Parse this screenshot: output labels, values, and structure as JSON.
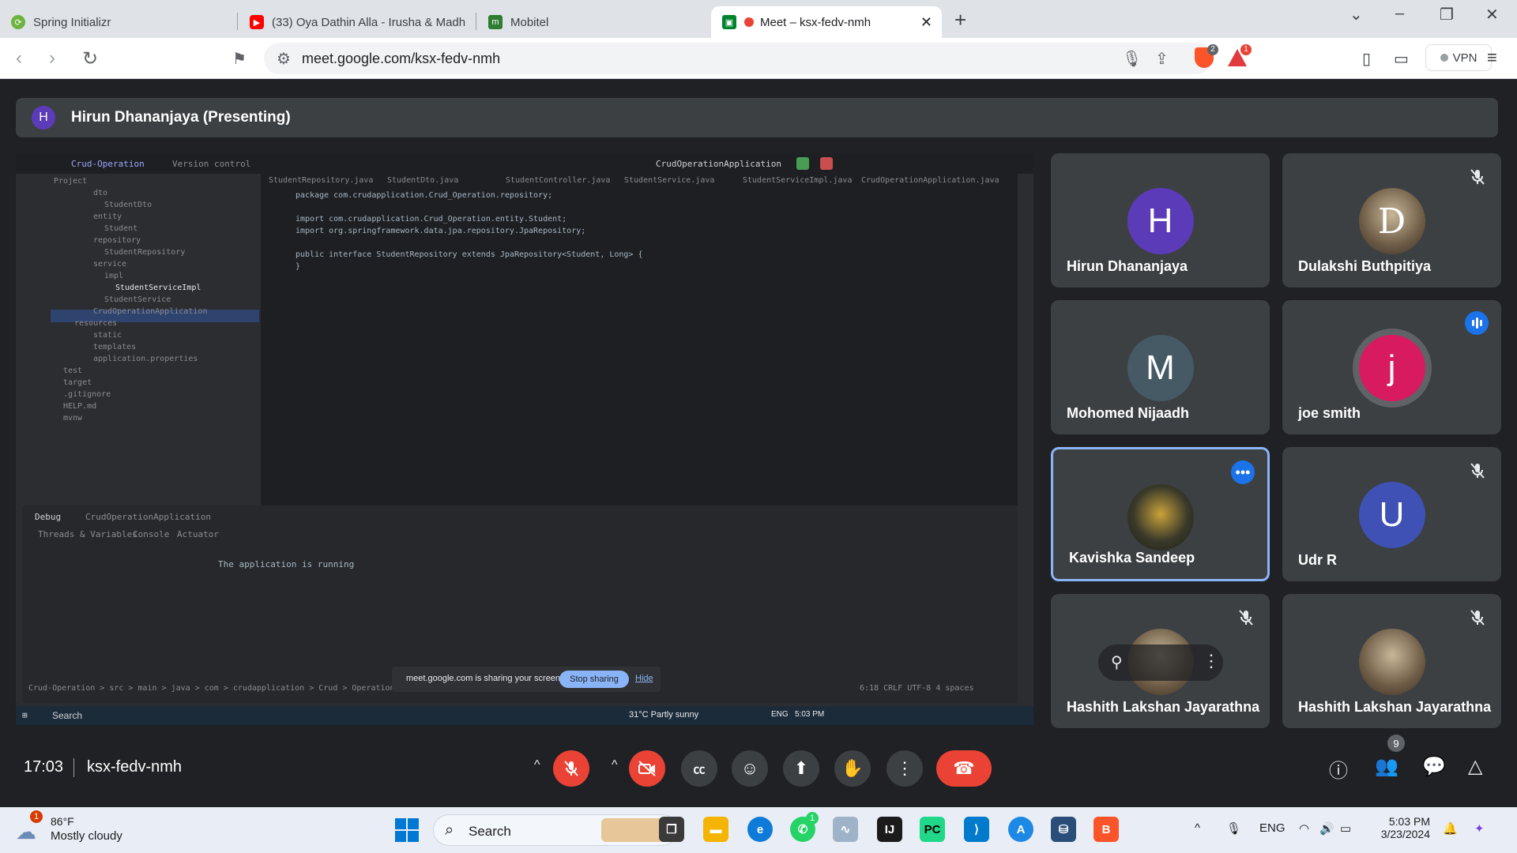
{
  "browser": {
    "tabs": [
      {
        "title": "Spring Initializr",
        "icon": "spring-icon"
      },
      {
        "title": "(33) Oya Dathin Alla - Irusha & Madh",
        "icon": "youtube-icon"
      },
      {
        "title": "Mobitel",
        "icon": "mobitel-icon"
      },
      {
        "title": "Meet – ksx-fedv-nmh",
        "icon": "meet-icon"
      }
    ],
    "url": "meet.google.com/ksx-fedv-nmh",
    "vpn_label": "VPN",
    "shields_badge": "2",
    "rewards_badge": "1"
  },
  "meet": {
    "presenter_initial": "H",
    "presenter_banner": "Hirun Dhananjaya (Presenting)",
    "participants": [
      {
        "name": "Hirun Dhananjaya",
        "initial": "H",
        "color": "#5b3bb8"
      },
      {
        "name": "Dulakshi Buthpitiya",
        "initial": "D",
        "color": "#c9b79a"
      },
      {
        "name": "Mohomed Nijaadh",
        "initial": "M",
        "color": "#455a64"
      },
      {
        "name": "joe smith",
        "initial": "j",
        "color": "#d81b60"
      },
      {
        "name": "Kavishka Sandeep",
        "initial": "",
        "color": "#4a4a3a"
      },
      {
        "name": "Udr R",
        "initial": "U",
        "color": "#3f51b5"
      },
      {
        "name": "Hashith Lakshan Jayarathna",
        "initial": "",
        "color": "#8d7a66"
      },
      {
        "name": "Hashith Lakshan Jayarathna",
        "initial": "",
        "color": "#8d7a66"
      }
    ],
    "more_options": "•••",
    "shared_screen": {
      "project_name": "Crud-Operation",
      "version_control": "Version control",
      "run_config": "CrudOperationApplication",
      "editor_tabs": [
        "StudentRepository.java",
        "StudentDto.java",
        "StudentController.java",
        "StudentService.java",
        "StudentServiceImpl.java",
        "CrudOperationApplication.java"
      ],
      "code_lines": [
        "package com.crudapplication.Crud_Operation.repository;",
        "",
        "import com.crudapplication.Crud_Operation.entity.Student;",
        "import org.springframework.data.jpa.repository.JpaRepository;",
        "",
        "public interface StudentRepository extends JpaRepository<Student, Long> {",
        "}"
      ],
      "project_tree": [
        "Project",
        "dto",
        "StudentDto",
        "entity",
        "Student",
        "repository",
        "StudentRepository",
        "service",
        "impl",
        "StudentServiceImpl",
        "StudentService",
        "CrudOperationApplication",
        "resources",
        "static",
        "templates",
        "application.properties",
        "test",
        "target",
        ".gitignore",
        "HELP.md",
        "mvnw"
      ],
      "debug_label": "Debug",
      "debug_config": "CrudOperationApplication",
      "debug_tabs": [
        "Threads & Variables",
        "Console",
        "Actuator"
      ],
      "debug_status": "The application is running",
      "breadcrumb": "Crud-Operation > src > main > java > com > crudapplication > Crud > Operation",
      "status_right": "6:18   CRLF   UTF-8   4 spaces",
      "share_notice": "meet.google.com is sharing your screen.",
      "stop_sharing": "Stop sharing",
      "hide": "Hide",
      "inner_taskbar_search": "Search",
      "inner_weather": "31°C  Partly sunny",
      "inner_lang": "ENG",
      "inner_time": "5:03 PM"
    },
    "time": "17:03",
    "meeting_code": "ksx-fedv-nmh",
    "people_count": "9"
  },
  "taskbar": {
    "weather_temp": "86°F",
    "weather_cond": "Mostly cloudy",
    "weather_badge": "1",
    "search_label": "Search",
    "whatsapp_badge": "1",
    "lang": "ENG",
    "time": "5:03 PM",
    "date": "3/23/2024"
  }
}
